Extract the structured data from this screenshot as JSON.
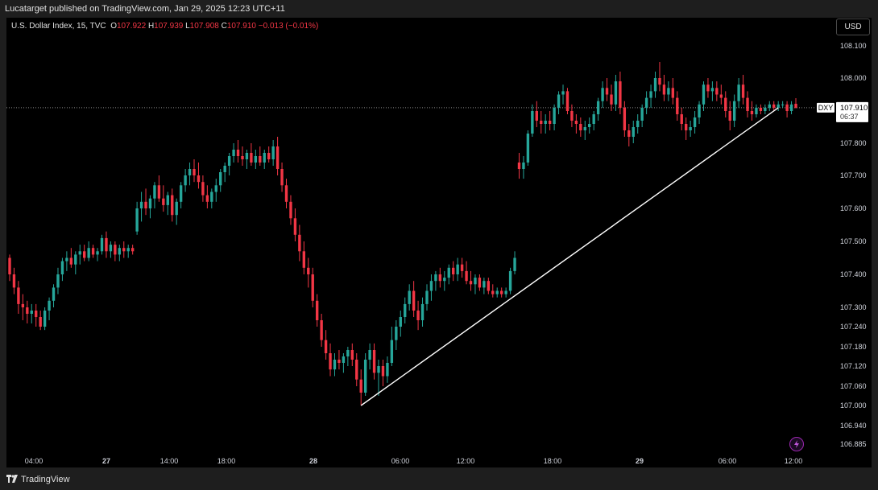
{
  "header": {
    "published": "Lucatarget published on TradingView.com, Jan 29, 2025 12:23 UTC+11"
  },
  "legend": {
    "symbol": "U.S. Dollar Index, 15, TVC",
    "o_label": "O",
    "o_value": "107.922",
    "h_label": "H",
    "h_value": "107.939",
    "l_label": "L",
    "l_value": "107.908",
    "c_label": "C",
    "c_value": "107.910",
    "change": "−0.013 (−0.01%)"
  },
  "currency_button": "USD",
  "price_tag": {
    "symbol": "DXY",
    "price": "107.910",
    "countdown": "06:37"
  },
  "footer": {
    "brand": "TradingView"
  },
  "colors": {
    "up": "#26a69a",
    "down": "#f23645",
    "background": "#000000",
    "trendline": "#ffffff"
  },
  "chart_data": {
    "type": "candlestick",
    "title": "U.S. Dollar Index, 15, TVC",
    "y_ticks": [
      "108.100",
      "108.000",
      "107.900",
      "107.800",
      "107.700",
      "107.600",
      "107.500",
      "107.400",
      "107.300",
      "107.240",
      "107.180",
      "107.120",
      "107.060",
      "107.000",
      "106.940",
      "106.885"
    ],
    "x_ticks": [
      "04:00",
      "27",
      "14:00",
      "18:00",
      "28",
      "06:00",
      "12:00",
      "18:00",
      "29",
      "06:00",
      "12:00"
    ],
    "bold_x_ticks": [
      "27",
      "28",
      "29"
    ],
    "last_price": 107.91,
    "series": [
      {
        "o": 107.45,
        "h": 107.46,
        "l": 107.38,
        "c": 107.4
      },
      {
        "o": 107.4,
        "h": 107.42,
        "l": 107.34,
        "c": 107.36
      },
      {
        "o": 107.36,
        "h": 107.38,
        "l": 107.28,
        "c": 107.31
      },
      {
        "o": 107.31,
        "h": 107.34,
        "l": 107.26,
        "c": 107.3
      },
      {
        "o": 107.3,
        "h": 107.32,
        "l": 107.25,
        "c": 107.28
      },
      {
        "o": 107.28,
        "h": 107.31,
        "l": 107.25,
        "c": 107.29
      },
      {
        "o": 107.29,
        "h": 107.31,
        "l": 107.24,
        "c": 107.27
      },
      {
        "o": 107.27,
        "h": 107.29,
        "l": 107.23,
        "c": 107.24
      },
      {
        "o": 107.24,
        "h": 107.3,
        "l": 107.23,
        "c": 107.29
      },
      {
        "o": 107.29,
        "h": 107.33,
        "l": 107.26,
        "c": 107.32
      },
      {
        "o": 107.32,
        "h": 107.37,
        "l": 107.3,
        "c": 107.36
      },
      {
        "o": 107.36,
        "h": 107.42,
        "l": 107.34,
        "c": 107.4
      },
      {
        "o": 107.4,
        "h": 107.45,
        "l": 107.38,
        "c": 107.44
      },
      {
        "o": 107.44,
        "h": 107.47,
        "l": 107.41,
        "c": 107.45
      },
      {
        "o": 107.45,
        "h": 107.48,
        "l": 107.42,
        "c": 107.43
      },
      {
        "o": 107.43,
        "h": 107.47,
        "l": 107.4,
        "c": 107.46
      },
      {
        "o": 107.46,
        "h": 107.49,
        "l": 107.43,
        "c": 107.47
      },
      {
        "o": 107.47,
        "h": 107.49,
        "l": 107.44,
        "c": 107.45
      },
      {
        "o": 107.45,
        "h": 107.5,
        "l": 107.44,
        "c": 107.48
      },
      {
        "o": 107.48,
        "h": 107.49,
        "l": 107.45,
        "c": 107.46
      },
      {
        "o": 107.46,
        "h": 107.48,
        "l": 107.44,
        "c": 107.47
      },
      {
        "o": 107.47,
        "h": 107.52,
        "l": 107.46,
        "c": 107.51
      },
      {
        "o": 107.51,
        "h": 107.53,
        "l": 107.45,
        "c": 107.47
      },
      {
        "o": 107.47,
        "h": 107.5,
        "l": 107.45,
        "c": 107.49
      },
      {
        "o": 107.49,
        "h": 107.5,
        "l": 107.44,
        "c": 107.46
      },
      {
        "o": 107.46,
        "h": 107.49,
        "l": 107.44,
        "c": 107.48
      },
      {
        "o": 107.48,
        "h": 107.5,
        "l": 107.45,
        "c": 107.47
      },
      {
        "o": 107.47,
        "h": 107.49,
        "l": 107.45,
        "c": 107.48
      },
      {
        "o": 107.48,
        "h": 107.49,
        "l": 107.46,
        "c": 107.47
      },
      {
        "o": 107.53,
        "h": 107.62,
        "l": 107.52,
        "c": 107.6
      },
      {
        "o": 107.6,
        "h": 107.65,
        "l": 107.56,
        "c": 107.62
      },
      {
        "o": 107.62,
        "h": 107.66,
        "l": 107.58,
        "c": 107.6
      },
      {
        "o": 107.6,
        "h": 107.64,
        "l": 107.57,
        "c": 107.63
      },
      {
        "o": 107.63,
        "h": 107.68,
        "l": 107.6,
        "c": 107.67
      },
      {
        "o": 107.67,
        "h": 107.7,
        "l": 107.62,
        "c": 107.63
      },
      {
        "o": 107.63,
        "h": 107.67,
        "l": 107.59,
        "c": 107.61
      },
      {
        "o": 107.61,
        "h": 107.65,
        "l": 107.58,
        "c": 107.64
      },
      {
        "o": 107.64,
        "h": 107.66,
        "l": 107.56,
        "c": 107.58
      },
      {
        "o": 107.58,
        "h": 107.63,
        "l": 107.55,
        "c": 107.62
      },
      {
        "o": 107.62,
        "h": 107.68,
        "l": 107.6,
        "c": 107.67
      },
      {
        "o": 107.67,
        "h": 107.72,
        "l": 107.65,
        "c": 107.7
      },
      {
        "o": 107.7,
        "h": 107.74,
        "l": 107.67,
        "c": 107.72
      },
      {
        "o": 107.72,
        "h": 107.75,
        "l": 107.68,
        "c": 107.7
      },
      {
        "o": 107.7,
        "h": 107.74,
        "l": 107.66,
        "c": 107.68
      },
      {
        "o": 107.68,
        "h": 107.7,
        "l": 107.62,
        "c": 107.64
      },
      {
        "o": 107.64,
        "h": 107.67,
        "l": 107.6,
        "c": 107.62
      },
      {
        "o": 107.62,
        "h": 107.66,
        "l": 107.6,
        "c": 107.65
      },
      {
        "o": 107.65,
        "h": 107.69,
        "l": 107.62,
        "c": 107.67
      },
      {
        "o": 107.67,
        "h": 107.72,
        "l": 107.65,
        "c": 107.71
      },
      {
        "o": 107.71,
        "h": 107.74,
        "l": 107.68,
        "c": 107.73
      },
      {
        "o": 107.73,
        "h": 107.77,
        "l": 107.7,
        "c": 107.76
      },
      {
        "o": 107.76,
        "h": 107.8,
        "l": 107.74,
        "c": 107.78
      },
      {
        "o": 107.78,
        "h": 107.81,
        "l": 107.74,
        "c": 107.76
      },
      {
        "o": 107.76,
        "h": 107.79,
        "l": 107.73,
        "c": 107.75
      },
      {
        "o": 107.75,
        "h": 107.78,
        "l": 107.72,
        "c": 107.77
      },
      {
        "o": 107.77,
        "h": 107.8,
        "l": 107.73,
        "c": 107.74
      },
      {
        "o": 107.74,
        "h": 107.78,
        "l": 107.72,
        "c": 107.76
      },
      {
        "o": 107.76,
        "h": 107.79,
        "l": 107.73,
        "c": 107.74
      },
      {
        "o": 107.74,
        "h": 107.78,
        "l": 107.72,
        "c": 107.77
      },
      {
        "o": 107.77,
        "h": 107.79,
        "l": 107.74,
        "c": 107.75
      },
      {
        "o": 107.75,
        "h": 107.81,
        "l": 107.73,
        "c": 107.79
      },
      {
        "o": 107.79,
        "h": 107.82,
        "l": 107.7,
        "c": 107.72
      },
      {
        "o": 107.72,
        "h": 107.74,
        "l": 107.65,
        "c": 107.67
      },
      {
        "o": 107.67,
        "h": 107.69,
        "l": 107.6,
        "c": 107.62
      },
      {
        "o": 107.62,
        "h": 107.64,
        "l": 107.55,
        "c": 107.57
      },
      {
        "o": 107.57,
        "h": 107.6,
        "l": 107.5,
        "c": 107.52
      },
      {
        "o": 107.52,
        "h": 107.55,
        "l": 107.44,
        "c": 107.47
      },
      {
        "o": 107.47,
        "h": 107.5,
        "l": 107.4,
        "c": 107.42
      },
      {
        "o": 107.42,
        "h": 107.45,
        "l": 107.36,
        "c": 107.4
      },
      {
        "o": 107.4,
        "h": 107.42,
        "l": 107.3,
        "c": 107.32
      },
      {
        "o": 107.32,
        "h": 107.34,
        "l": 107.24,
        "c": 107.26
      },
      {
        "o": 107.26,
        "h": 107.28,
        "l": 107.18,
        "c": 107.2
      },
      {
        "o": 107.2,
        "h": 107.23,
        "l": 107.14,
        "c": 107.16
      },
      {
        "o": 107.16,
        "h": 107.19,
        "l": 107.09,
        "c": 107.11
      },
      {
        "o": 107.11,
        "h": 107.16,
        "l": 107.09,
        "c": 107.14
      },
      {
        "o": 107.14,
        "h": 107.17,
        "l": 107.11,
        "c": 107.13
      },
      {
        "o": 107.13,
        "h": 107.16,
        "l": 107.1,
        "c": 107.15
      },
      {
        "o": 107.15,
        "h": 107.18,
        "l": 107.12,
        "c": 107.17
      },
      {
        "o": 107.17,
        "h": 107.19,
        "l": 107.12,
        "c": 107.14
      },
      {
        "o": 107.14,
        "h": 107.16,
        "l": 107.06,
        "c": 107.08
      },
      {
        "o": 107.08,
        "h": 107.11,
        "l": 107.0,
        "c": 107.04
      },
      {
        "o": 107.04,
        "h": 107.16,
        "l": 107.03,
        "c": 107.14
      },
      {
        "o": 107.14,
        "h": 107.19,
        "l": 107.11,
        "c": 107.17
      },
      {
        "o": 107.17,
        "h": 107.19,
        "l": 107.08,
        "c": 107.1
      },
      {
        "o": 107.1,
        "h": 107.14,
        "l": 107.03,
        "c": 107.12
      },
      {
        "o": 107.12,
        "h": 107.14,
        "l": 107.06,
        "c": 107.09
      },
      {
        "o": 107.09,
        "h": 107.15,
        "l": 107.07,
        "c": 107.13
      },
      {
        "o": 107.13,
        "h": 107.24,
        "l": 107.12,
        "c": 107.2
      },
      {
        "o": 107.2,
        "h": 107.26,
        "l": 107.17,
        "c": 107.24
      },
      {
        "o": 107.24,
        "h": 107.29,
        "l": 107.21,
        "c": 107.27
      },
      {
        "o": 107.27,
        "h": 107.33,
        "l": 107.25,
        "c": 107.31
      },
      {
        "o": 107.31,
        "h": 107.37,
        "l": 107.29,
        "c": 107.35
      },
      {
        "o": 107.35,
        "h": 107.38,
        "l": 107.27,
        "c": 107.29
      },
      {
        "o": 107.29,
        "h": 107.32,
        "l": 107.23,
        "c": 107.26
      },
      {
        "o": 107.26,
        "h": 107.33,
        "l": 107.24,
        "c": 107.31
      },
      {
        "o": 107.31,
        "h": 107.37,
        "l": 107.29,
        "c": 107.35
      },
      {
        "o": 107.35,
        "h": 107.4,
        "l": 107.32,
        "c": 107.38
      },
      {
        "o": 107.38,
        "h": 107.41,
        "l": 107.35,
        "c": 107.4
      },
      {
        "o": 107.4,
        "h": 107.42,
        "l": 107.36,
        "c": 107.38
      },
      {
        "o": 107.38,
        "h": 107.41,
        "l": 107.35,
        "c": 107.39
      },
      {
        "o": 107.39,
        "h": 107.43,
        "l": 107.37,
        "c": 107.42
      },
      {
        "o": 107.42,
        "h": 107.44,
        "l": 107.38,
        "c": 107.4
      },
      {
        "o": 107.4,
        "h": 107.45,
        "l": 107.38,
        "c": 107.43
      },
      {
        "o": 107.43,
        "h": 107.45,
        "l": 107.39,
        "c": 107.41
      },
      {
        "o": 107.41,
        "h": 107.44,
        "l": 107.37,
        "c": 107.38
      },
      {
        "o": 107.38,
        "h": 107.41,
        "l": 107.35,
        "c": 107.37
      },
      {
        "o": 107.37,
        "h": 107.4,
        "l": 107.34,
        "c": 107.39
      },
      {
        "o": 107.39,
        "h": 107.4,
        "l": 107.35,
        "c": 107.36
      },
      {
        "o": 107.36,
        "h": 107.39,
        "l": 107.34,
        "c": 107.38
      },
      {
        "o": 107.38,
        "h": 107.39,
        "l": 107.34,
        "c": 107.35
      },
      {
        "o": 107.35,
        "h": 107.37,
        "l": 107.33,
        "c": 107.34
      },
      {
        "o": 107.34,
        "h": 107.36,
        "l": 107.33,
        "c": 107.35
      },
      {
        "o": 107.35,
        "h": 107.36,
        "l": 107.33,
        "c": 107.34
      },
      {
        "o": 107.34,
        "h": 107.36,
        "l": 107.33,
        "c": 107.35
      },
      {
        "o": 107.35,
        "h": 107.42,
        "l": 107.34,
        "c": 107.41
      },
      {
        "o": 107.41,
        "h": 107.47,
        "l": 107.4,
        "c": 107.45
      },
      {
        "o": 107.74,
        "h": 107.77,
        "l": 107.69,
        "c": 107.72
      },
      {
        "o": 107.72,
        "h": 107.76,
        "l": 107.69,
        "c": 107.74
      },
      {
        "o": 107.74,
        "h": 107.84,
        "l": 107.73,
        "c": 107.83
      },
      {
        "o": 107.83,
        "h": 107.92,
        "l": 107.82,
        "c": 107.9
      },
      {
        "o": 107.9,
        "h": 107.93,
        "l": 107.85,
        "c": 107.87
      },
      {
        "o": 107.87,
        "h": 107.9,
        "l": 107.83,
        "c": 107.86
      },
      {
        "o": 107.86,
        "h": 107.89,
        "l": 107.83,
        "c": 107.87
      },
      {
        "o": 107.87,
        "h": 107.9,
        "l": 107.84,
        "c": 107.86
      },
      {
        "o": 107.86,
        "h": 107.92,
        "l": 107.84,
        "c": 107.91
      },
      {
        "o": 107.91,
        "h": 107.96,
        "l": 107.89,
        "c": 107.95
      },
      {
        "o": 107.95,
        "h": 107.98,
        "l": 107.92,
        "c": 107.96
      },
      {
        "o": 107.96,
        "h": 107.97,
        "l": 107.89,
        "c": 107.9
      },
      {
        "o": 107.9,
        "h": 107.92,
        "l": 107.85,
        "c": 107.87
      },
      {
        "o": 107.87,
        "h": 107.89,
        "l": 107.83,
        "c": 107.86
      },
      {
        "o": 107.86,
        "h": 107.88,
        "l": 107.82,
        "c": 107.84
      },
      {
        "o": 107.84,
        "h": 107.87,
        "l": 107.81,
        "c": 107.85
      },
      {
        "o": 107.85,
        "h": 107.88,
        "l": 107.83,
        "c": 107.86
      },
      {
        "o": 107.86,
        "h": 107.9,
        "l": 107.84,
        "c": 107.89
      },
      {
        "o": 107.89,
        "h": 107.94,
        "l": 107.87,
        "c": 107.93
      },
      {
        "o": 107.93,
        "h": 107.99,
        "l": 107.91,
        "c": 107.97
      },
      {
        "o": 107.97,
        "h": 108.0,
        "l": 107.93,
        "c": 107.95
      },
      {
        "o": 107.95,
        "h": 107.98,
        "l": 107.9,
        "c": 107.92
      },
      {
        "o": 107.92,
        "h": 108.01,
        "l": 107.9,
        "c": 107.99
      },
      {
        "o": 107.99,
        "h": 108.02,
        "l": 107.89,
        "c": 107.91
      },
      {
        "o": 107.91,
        "h": 107.93,
        "l": 107.82,
        "c": 107.84
      },
      {
        "o": 107.84,
        "h": 107.86,
        "l": 107.79,
        "c": 107.82
      },
      {
        "o": 107.82,
        "h": 107.87,
        "l": 107.8,
        "c": 107.85
      },
      {
        "o": 107.85,
        "h": 107.89,
        "l": 107.83,
        "c": 107.87
      },
      {
        "o": 107.87,
        "h": 107.92,
        "l": 107.85,
        "c": 107.91
      },
      {
        "o": 107.91,
        "h": 107.96,
        "l": 107.89,
        "c": 107.94
      },
      {
        "o": 107.94,
        "h": 107.98,
        "l": 107.91,
        "c": 107.96
      },
      {
        "o": 107.96,
        "h": 108.02,
        "l": 107.94,
        "c": 108.0
      },
      {
        "o": 108.0,
        "h": 108.05,
        "l": 107.96,
        "c": 107.98
      },
      {
        "o": 107.98,
        "h": 108.01,
        "l": 107.93,
        "c": 107.95
      },
      {
        "o": 107.95,
        "h": 107.99,
        "l": 107.93,
        "c": 107.97
      },
      {
        "o": 107.97,
        "h": 108.0,
        "l": 107.92,
        "c": 107.94
      },
      {
        "o": 107.94,
        "h": 107.96,
        "l": 107.87,
        "c": 107.89
      },
      {
        "o": 107.89,
        "h": 107.91,
        "l": 107.84,
        "c": 107.86
      },
      {
        "o": 107.86,
        "h": 107.88,
        "l": 107.81,
        "c": 107.84
      },
      {
        "o": 107.84,
        "h": 107.87,
        "l": 107.82,
        "c": 107.85
      },
      {
        "o": 107.85,
        "h": 107.9,
        "l": 107.83,
        "c": 107.88
      },
      {
        "o": 107.88,
        "h": 107.93,
        "l": 107.86,
        "c": 107.92
      },
      {
        "o": 107.92,
        "h": 107.99,
        "l": 107.9,
        "c": 107.98
      },
      {
        "o": 107.98,
        "h": 108.0,
        "l": 107.94,
        "c": 107.96
      },
      {
        "o": 107.96,
        "h": 107.99,
        "l": 107.93,
        "c": 107.97
      },
      {
        "o": 107.97,
        "h": 107.99,
        "l": 107.93,
        "c": 107.95
      },
      {
        "o": 107.95,
        "h": 107.98,
        "l": 107.92,
        "c": 107.94
      },
      {
        "o": 107.94,
        "h": 107.96,
        "l": 107.88,
        "c": 107.9
      },
      {
        "o": 107.9,
        "h": 107.93,
        "l": 107.84,
        "c": 107.87
      },
      {
        "o": 107.87,
        "h": 107.95,
        "l": 107.85,
        "c": 107.93
      },
      {
        "o": 107.93,
        "h": 108.0,
        "l": 107.91,
        "c": 107.98
      },
      {
        "o": 107.98,
        "h": 108.01,
        "l": 107.92,
        "c": 107.94
      },
      {
        "o": 107.94,
        "h": 107.96,
        "l": 107.88,
        "c": 107.9
      },
      {
        "o": 107.9,
        "h": 107.93,
        "l": 107.87,
        "c": 107.89
      },
      {
        "o": 107.89,
        "h": 107.92,
        "l": 107.88,
        "c": 107.91
      },
      {
        "o": 107.91,
        "h": 107.92,
        "l": 107.89,
        "c": 107.9
      },
      {
        "o": 107.9,
        "h": 107.92,
        "l": 107.89,
        "c": 107.91
      },
      {
        "o": 107.91,
        "h": 107.93,
        "l": 107.9,
        "c": 107.92
      },
      {
        "o": 107.92,
        "h": 107.93,
        "l": 107.9,
        "c": 107.91
      },
      {
        "o": 107.91,
        "h": 107.93,
        "l": 107.9,
        "c": 107.92
      },
      {
        "o": 107.92,
        "h": 107.93,
        "l": 107.91,
        "c": 107.92
      },
      {
        "o": 107.92,
        "h": 107.93,
        "l": 107.88,
        "c": 107.9
      },
      {
        "o": 107.9,
        "h": 107.93,
        "l": 107.89,
        "c": 107.92
      },
      {
        "o": 107.922,
        "h": 107.939,
        "l": 107.908,
        "c": 107.91
      }
    ],
    "trendline": {
      "from": {
        "index": 80,
        "price": 107.0
      },
      "to": {
        "index": 175,
        "price": 107.91
      }
    }
  }
}
